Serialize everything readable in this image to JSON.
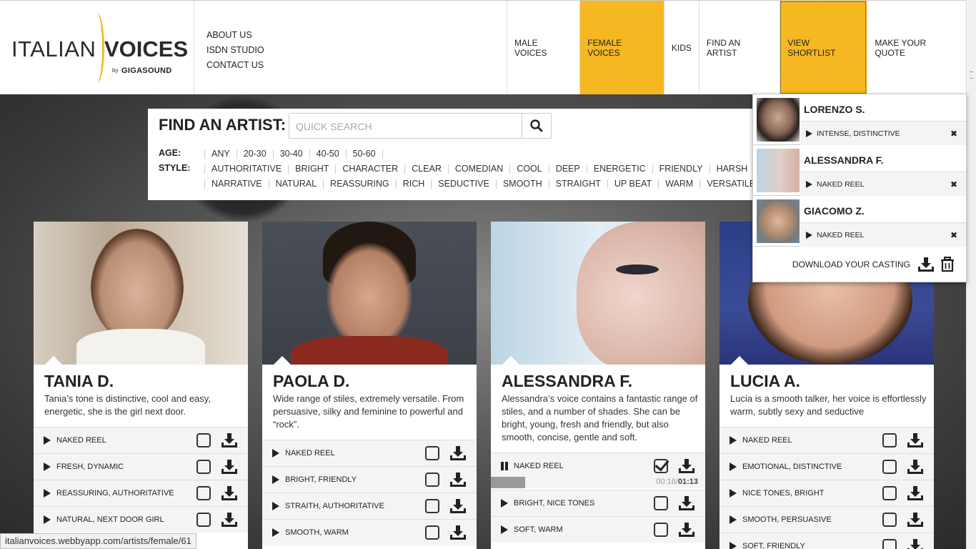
{
  "logo": {
    "word1": "ITALIAN",
    "word2": "VOICES",
    "by": "by",
    "brand": "GIGASOUND"
  },
  "topnav": [
    "ABOUT US",
    "ISDN STUDIO",
    "CONTACT US"
  ],
  "mainnav": [
    {
      "label": "MALE VOICES",
      "state": "normal"
    },
    {
      "label": "FEMALE VOICES",
      "state": "active"
    },
    {
      "label": "KIDS",
      "state": "normal"
    },
    {
      "label": "FIND AN ARTIST",
      "state": "normal"
    },
    {
      "label": "VIEW SHORTLIST",
      "state": "focused"
    },
    {
      "label": "MAKE YOUR QUOTE",
      "state": "normal"
    }
  ],
  "accent_color": "#f5b820",
  "find": {
    "title": "FIND AN ARTIST:",
    "search_placeholder": "QUICK SEARCH",
    "age_label": "AGE:",
    "ages": [
      "ANY",
      "20-30",
      "30-40",
      "40-50",
      "50-60"
    ],
    "style_label": "STYLE:",
    "styles_row1": [
      "AUTHORITATIVE",
      "BRIGHT",
      "CHARACTER",
      "CLEAR",
      "COMEDIAN",
      "COOL",
      "DEEP",
      "ENERGETIC",
      "FRIENDLY",
      "HARSH"
    ],
    "styles_row2": [
      "NARRATIVE",
      "NATURAL",
      "REASSURING",
      "RICH",
      "SEDUCTIVE",
      "SMOOTH",
      "STRAIGHT",
      "UP BEAT",
      "WARM",
      "VERSATILE"
    ]
  },
  "cards": [
    {
      "name": "TANIA D.",
      "desc": "Tania’s tone is distinctive, cool and easy, energetic, she is the girl next door.",
      "tracks": [
        "NAKED REEL",
        "FRESH, DYNAMIC",
        "REASSURING, AUTHORITATIVE",
        "NATURAL, NEXT DOOR GIRL"
      ]
    },
    {
      "name": "PAOLA D.",
      "desc": "Wide range of stiles, extremely versatile. From persuasive, silky and feminine to powerful and “rock”.",
      "tracks": [
        "NAKED REEL",
        "BRIGHT, FRIENDLY",
        "STRAITH, AUTHORITATIVE",
        "SMOOTH, WARM"
      ]
    },
    {
      "name": "ALESSANDRA F.",
      "desc": "Alessandra’s voice contains a fantastic range of stiles, and a number of shades. She can be bright, young, fresh and friendly, but also smooth, concise, gentle and soft.",
      "tracks": [
        "NAKED REEL",
        "BRIGHT, NICE TONES",
        "SOFT, WARM"
      ],
      "player": {
        "elapsed": "00:16",
        "total": "01:13",
        "progress": 0.16
      }
    },
    {
      "name": "LUCIA A.",
      "desc": "Lucia is a smooth talker, her voice is effortlessly warm, subtly sexy and seductive",
      "tracks": [
        "NAKED REEL",
        "EMOTIONAL, DISTINCTIVE",
        "NICE TONES, BRIGHT",
        "SMOOTH, PERSUASIVE",
        "SOFT, FRIENDLY"
      ]
    }
  ],
  "shortlist": {
    "items": [
      {
        "name": "LORENZO S.",
        "track": "INTENSE, DISTINCTIVE"
      },
      {
        "name": "ALESSANDRA F.",
        "track": "NAKED REEL"
      },
      {
        "name": "GIACOMO Z.",
        "track": "NAKED REEL"
      }
    ],
    "download_label": "DOWNLOAD YOUR CASTING"
  },
  "status_url": "italianvoices.webbyapp.com/artists/female/61"
}
